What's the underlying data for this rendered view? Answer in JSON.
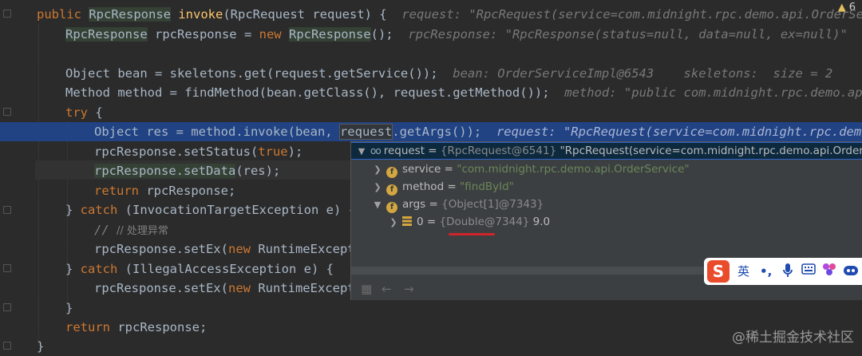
{
  "top_right_badge": "6",
  "code": {
    "l1_kw": "public",
    "l1_type": "RpcResponse",
    "l1_fn": "invoke",
    "l1_rest": "(RpcRequest request) {",
    "l1_hint": "request: \"RpcRequest(service=com.midnight.rpc.demo.api.OrderService",
    "l2_type": "RpcResponse",
    "l2_mid": " rpcResponse = ",
    "l2_kw": "new",
    "l2_type2": "RpcResponse",
    "l2_end": "();",
    "l2_hint": "rpcResponse: \"RpcResponse(status=null, data=null, ex=null)\"",
    "l3_code": "Object bean = skeletons.get(request.getService());",
    "l3_hint": "bean: OrderServiceImpl@6543    skeletons:  size = 2",
    "l4_code": "Method method = findMethod(bean.getClass(), request.getMethod());",
    "l4_hint": "method: \"public com.midnight.rpc.demo.api.Or",
    "l5_kw": "try",
    "l5_end": " {",
    "l6_a": "Object res = method.invoke(bean, ",
    "l6_b": "request",
    "l6_c": ".getArgs());",
    "l6_hint": "request: \"RpcRequest(service=com.midnight.rpc.demo.api",
    "l7_a": "rpcResponse.setStatus(",
    "l7_kw": "true",
    "l7_b": ");",
    "l8_a": "rpcResponse.setData",
    "l8_b": "(res);",
    "l9_kw": "return",
    "l9_b": " rpcResponse;",
    "l10_a": "} ",
    "l10_kw": "catch",
    "l10_b": " (InvocationTargetException e) {",
    "l11_comment": "// 处理异常",
    "l12_a": "rpcResponse.setEx(",
    "l12_kw": "new",
    "l12_b": " RuntimeExcepti",
    "l13_a": "} ",
    "l13_kw": "catch",
    "l13_b": " (IllegalAccessException e) {",
    "l14_a": "rpcResponse.setEx(",
    "l14_kw": "new",
    "l14_b": " RuntimeExcepti",
    "l15": "}",
    "l16_kw": "return",
    "l16_b": " rpcResponse;",
    "l17": "}"
  },
  "popup": {
    "root_name": "request",
    "root_eq": " = ",
    "root_ref": "{RpcRequest@6541}",
    "root_val": " \"RpcRequest(service=com.midnight.rpc.demo.api.OrderServic",
    "service_name": "service",
    "service_val": "\"com.midnight.rpc.demo.api.OrderService\"",
    "method_name": "method",
    "method_val": "\"findById\"",
    "args_name": "args",
    "args_ref": "{Object[1]@7343}",
    "item_name": "0",
    "item_ref": "{Double@7344}",
    "item_val": " 9.0",
    "eq": " = "
  },
  "ime": {
    "logo": "S",
    "lang": "英",
    "punct": "•,"
  },
  "watermark": "@稀土掘金技术社区",
  "colors": {
    "background": "#2b2b2b",
    "keyword": "#cc7832",
    "method": "#ffc66d",
    "string": "#6a8759",
    "selection": "#214283",
    "annotation_underline": "#d2232a"
  }
}
